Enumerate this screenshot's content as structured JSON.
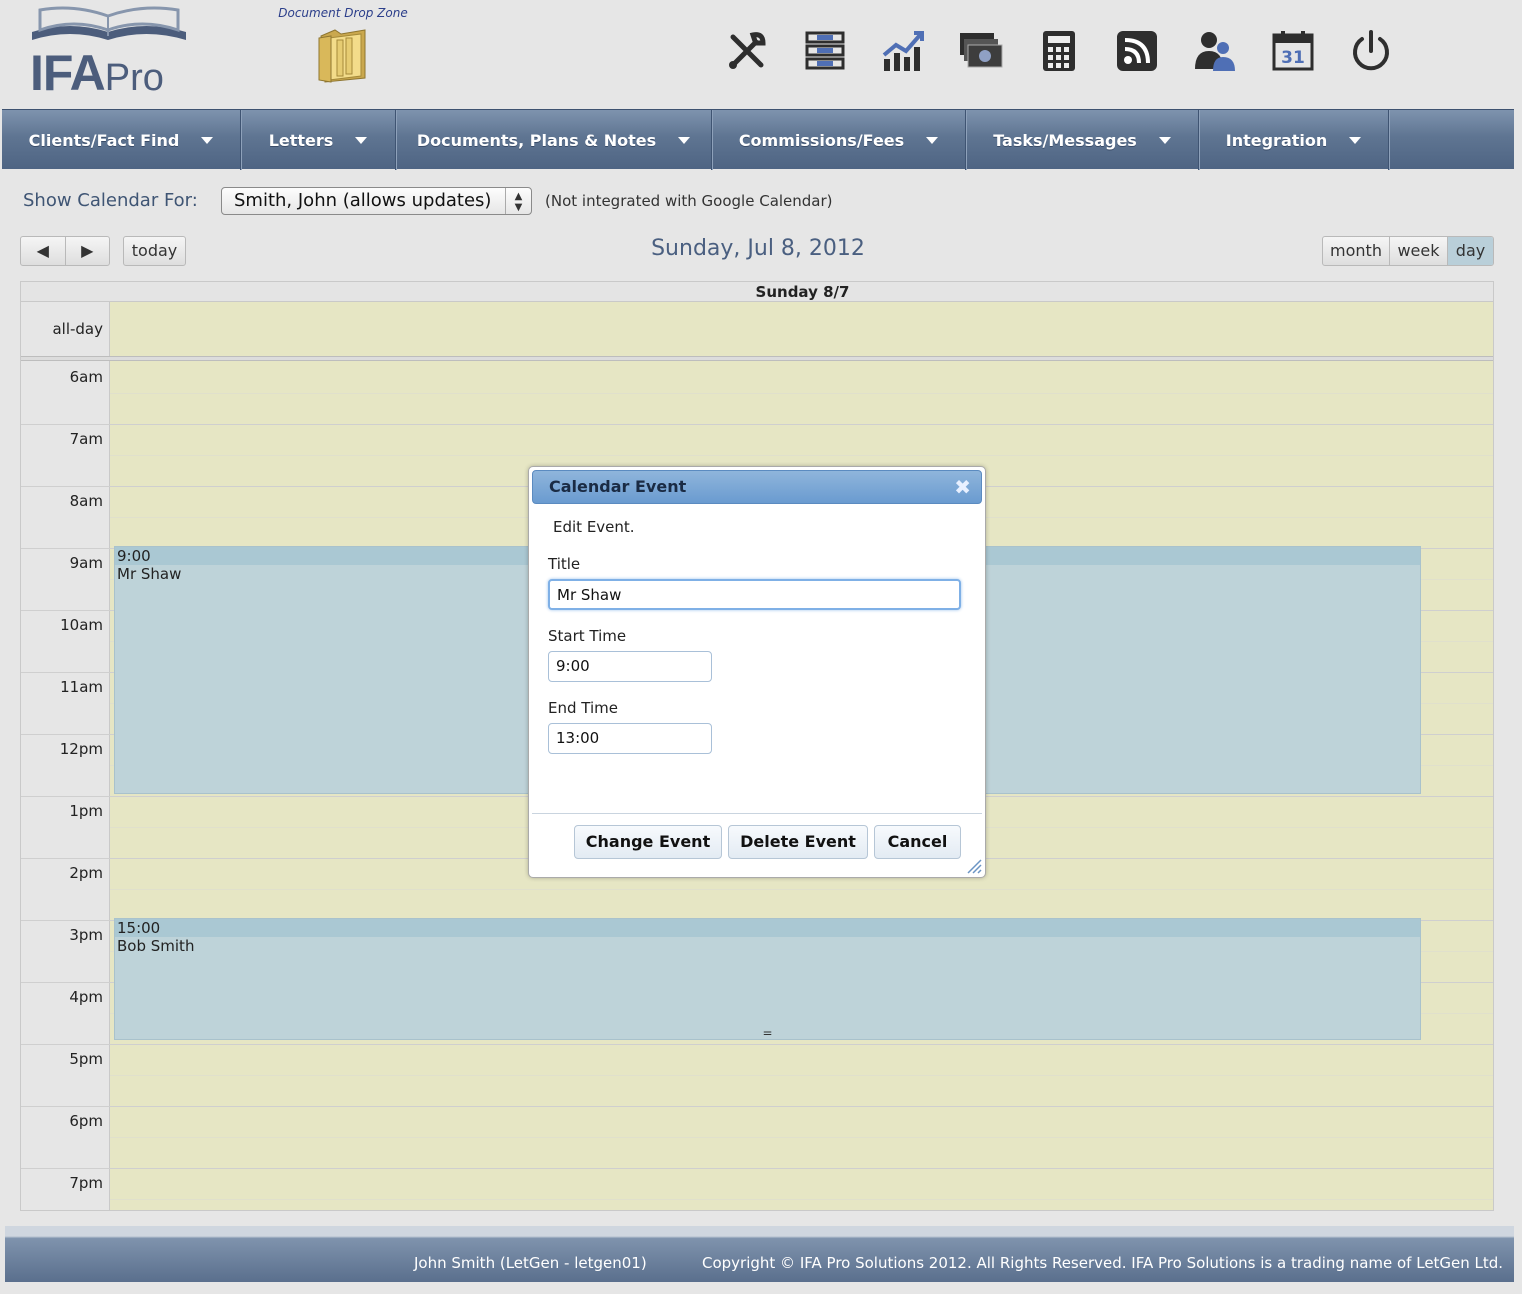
{
  "header": {
    "logo_ifa": "IFA",
    "logo_pro": "Pro",
    "drop_zone_label": "Document Drop Zone"
  },
  "toolbar": [
    {
      "name": "tools-icon"
    },
    {
      "name": "filing-icon"
    },
    {
      "name": "chart-icon"
    },
    {
      "name": "money-icon"
    },
    {
      "name": "calculator-icon"
    },
    {
      "name": "rss-icon"
    },
    {
      "name": "users-icon"
    },
    {
      "name": "calendar-icon",
      "text": "31"
    },
    {
      "name": "power-icon"
    }
  ],
  "nav": [
    {
      "label": "Clients/Fact Find"
    },
    {
      "label": "Letters"
    },
    {
      "label": "Documents, Plans & Notes"
    },
    {
      "label": "Commissions/Fees"
    },
    {
      "label": "Tasks/Messages"
    },
    {
      "label": "Integration"
    }
  ],
  "calendar_controls": {
    "show_for_label": "Show Calendar For:",
    "selected_user": "Smith, John (allows updates)",
    "integration_note": "(Not integrated with Google Calendar)",
    "prev_icon": "◀",
    "next_icon": "▶",
    "today_label": "today",
    "date_title": "Sunday, Jul 8, 2012",
    "views": [
      "month",
      "week",
      "day"
    ],
    "active_view": "day"
  },
  "calendar": {
    "column_header": "Sunday 8/7",
    "allday_label": "all-day",
    "hours": [
      "6am",
      "7am",
      "8am",
      "9am",
      "10am",
      "11am",
      "12pm",
      "1pm",
      "2pm",
      "3pm",
      "4pm",
      "5pm",
      "6pm",
      "7pm"
    ],
    "events": [
      {
        "time": "9:00",
        "title": "Mr Shaw"
      },
      {
        "time": "15:00",
        "title": "Bob Smith",
        "resize_handle": "="
      }
    ]
  },
  "dialog": {
    "title": "Calendar Event",
    "close_icon": "✖",
    "message": "Edit Event.",
    "title_label": "Title",
    "title_value": "Mr Shaw",
    "start_label": "Start Time",
    "start_value": "9:00",
    "end_label": "End Time",
    "end_value": "13:00",
    "change_button": "Change Event",
    "delete_button": "Delete Event",
    "cancel_button": "Cancel"
  },
  "footer": {
    "user": "John Smith (LetGen - letgen01)",
    "copyright": "Copyright © IFA Pro Solutions 2012. All Rights Reserved. IFA Pro Solutions is a trading name of LetGen Ltd."
  },
  "colors": {
    "nav": "#5f7592",
    "event": "#bed3d9",
    "grid": "#e6e6c4",
    "dialog_title": "#7aa6d6"
  }
}
